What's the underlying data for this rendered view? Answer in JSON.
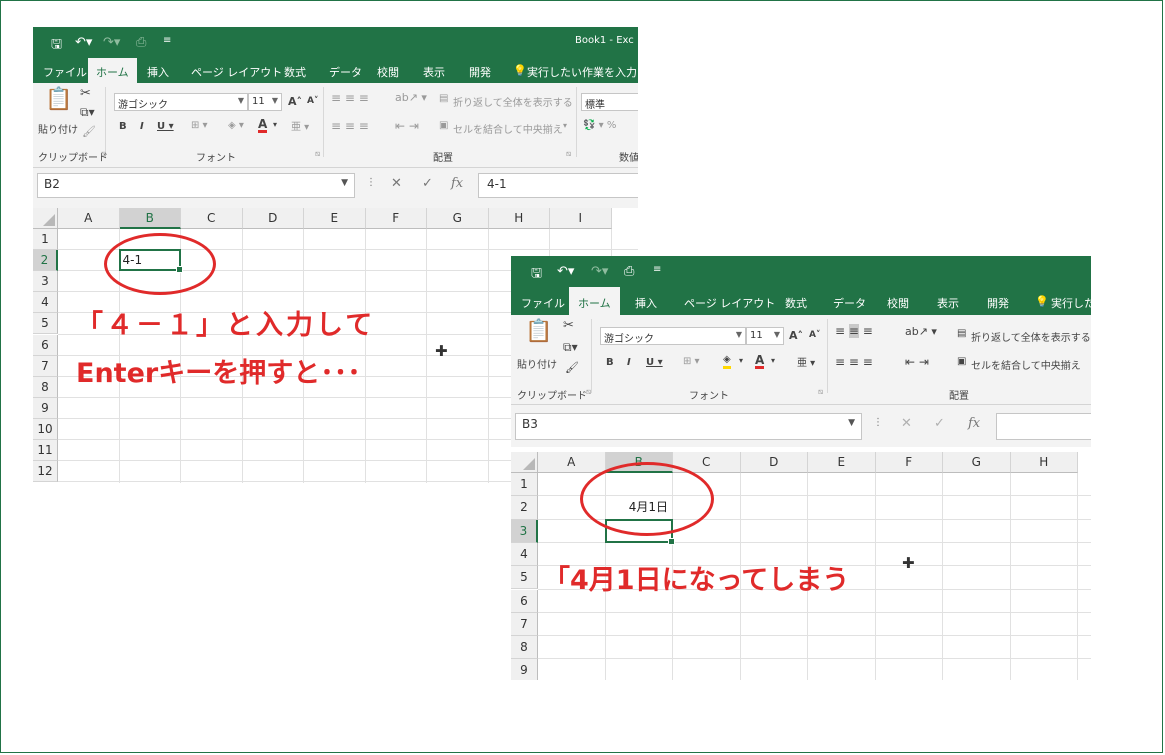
{
  "window1": {
    "title": "Book1 - Exc",
    "tabs": [
      "ファイル",
      "ホーム",
      "挿入",
      "ページ レイアウト",
      "数式",
      "データ",
      "校閲",
      "表示",
      "開発"
    ],
    "active_tab": "ホーム",
    "tell_me": "実行したい作業を入力して",
    "ribbon": {
      "paste_label": "貼り付け",
      "font_name": "游ゴシック",
      "font_size": "11",
      "wrap_text": "折り返して全体を表示する",
      "merge_center": "セルを結合して中央揃え",
      "number_format": "標準",
      "group_clipboard": "クリップボード",
      "group_font": "フォント",
      "group_alignment": "配置",
      "group_number": "数値"
    },
    "name_box": "B2",
    "formula": "4-1",
    "columns": [
      "A",
      "B",
      "C",
      "D",
      "E",
      "F",
      "G",
      "H",
      "I"
    ],
    "rows": [
      "1",
      "2",
      "3",
      "4",
      "5",
      "6",
      "7",
      "8",
      "9",
      "10",
      "11",
      "12"
    ],
    "selected_column": "B",
    "selected_row": "2",
    "cell_value": "4-1"
  },
  "window2": {
    "tabs": [
      "ファイル",
      "ホーム",
      "挿入",
      "ページ レイアウト",
      "数式",
      "データ",
      "校閲",
      "表示",
      "開発"
    ],
    "active_tab": "ホーム",
    "tell_me": "実行した",
    "ribbon": {
      "paste_label": "貼り付け",
      "font_name": "游ゴシック",
      "font_size": "11",
      "wrap_text": "折り返して全体を表示する",
      "merge_center": "セルを結合して中央揃え",
      "group_clipboard": "クリップボード",
      "group_font": "フォント",
      "group_alignment": "配置"
    },
    "name_box": "B3",
    "formula": "",
    "columns": [
      "A",
      "B",
      "C",
      "D",
      "E",
      "F",
      "G",
      "H"
    ],
    "rows": [
      "1",
      "2",
      "3",
      "4",
      "5",
      "6",
      "7",
      "8",
      "9"
    ],
    "selected_column": "B",
    "selected_row": "3",
    "cell_value": "4月1日"
  },
  "annotations": {
    "line1": "「４－１」と入力して",
    "line2": "Enterキーを押すと･･･",
    "line3": "「4月1日になってしまう"
  },
  "colors": {
    "excel_green": "#217346",
    "annotation_red": "#e02a2a"
  }
}
